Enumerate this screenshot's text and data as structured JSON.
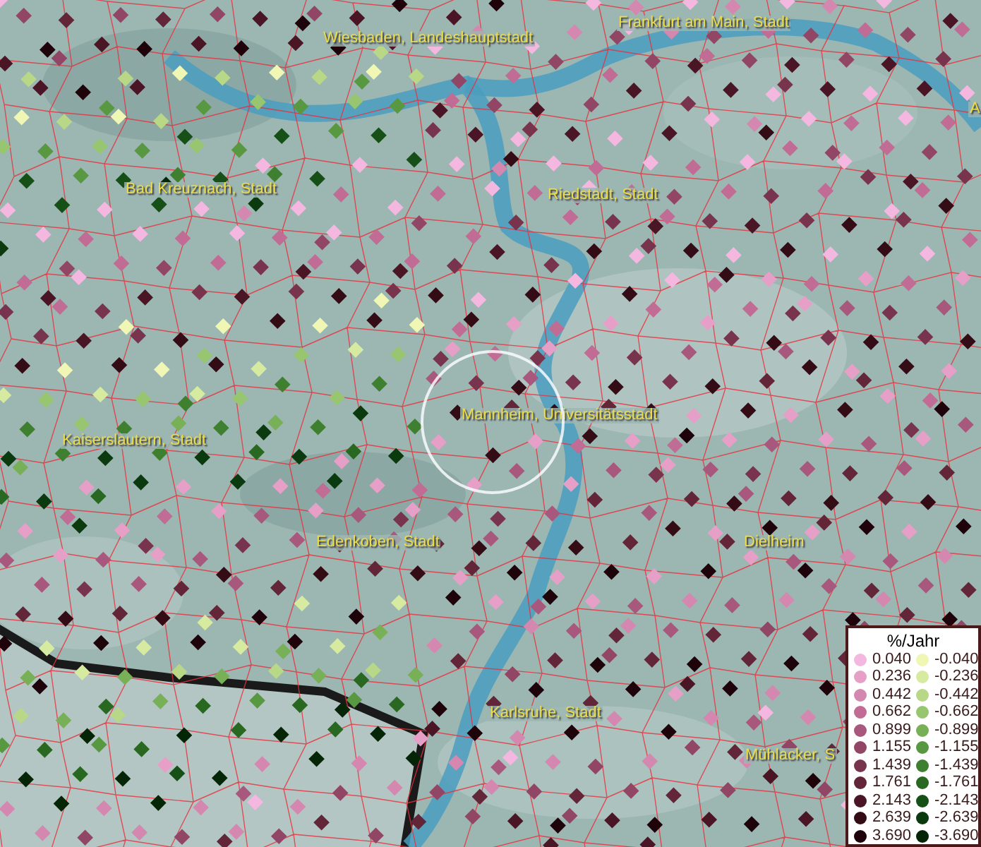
{
  "map": {
    "place_labels": [
      {
        "text": "Wiesbaden, Landeshauptstadt"
      },
      {
        "text": "Frankfurt am Main, Stadt"
      },
      {
        "text": "A"
      },
      {
        "text": "Bad Kreuznach, Stadt"
      },
      {
        "text": "Riedstadt, Stadt"
      },
      {
        "text": "Kaiserslautern, Stadt"
      },
      {
        "text": "Mannheim, Universitätsstadt"
      },
      {
        "text": "Edenkoben, Stadt"
      },
      {
        "text": "Dielheim"
      },
      {
        "text": "Karlsruhe, Stadt"
      },
      {
        "text": "Mühlacker, S"
      }
    ]
  },
  "legend": {
    "title": "%/Jahr",
    "entries": [
      {
        "label": "0.040",
        "color": "#f4b8e0"
      },
      {
        "label": "0.236",
        "color": "#e6a0c8"
      },
      {
        "label": "0.442",
        "color": "#d488b0"
      },
      {
        "label": "0.662",
        "color": "#c06c94"
      },
      {
        "label": "0.899",
        "color": "#a8587c"
      },
      {
        "label": "1.155",
        "color": "#904664"
      },
      {
        "label": "1.439",
        "color": "#78344c"
      },
      {
        "label": "1.761",
        "color": "#622638"
      },
      {
        "label": "2.143",
        "color": "#4a1626"
      },
      {
        "label": "2.639",
        "color": "#340c16"
      },
      {
        "label": "3.690",
        "color": "#1e040a"
      },
      {
        "label": "-0.040",
        "color": "#f0f6b4"
      },
      {
        "label": "-0.236",
        "color": "#d6eaa0"
      },
      {
        "label": "-0.442",
        "color": "#b8d888"
      },
      {
        "label": "-0.662",
        "color": "#98c670"
      },
      {
        "label": "-0.899",
        "color": "#78b058"
      },
      {
        "label": "-1.155",
        "color": "#589840"
      },
      {
        "label": "-1.439",
        "color": "#3e8030"
      },
      {
        "label": "-1.761",
        "color": "#286820"
      },
      {
        "label": "-2.143",
        "color": "#165016"
      },
      {
        "label": "-2.639",
        "color": "#0a3a0e"
      },
      {
        "label": "-3.690",
        "color": "#042606"
      }
    ]
  }
}
